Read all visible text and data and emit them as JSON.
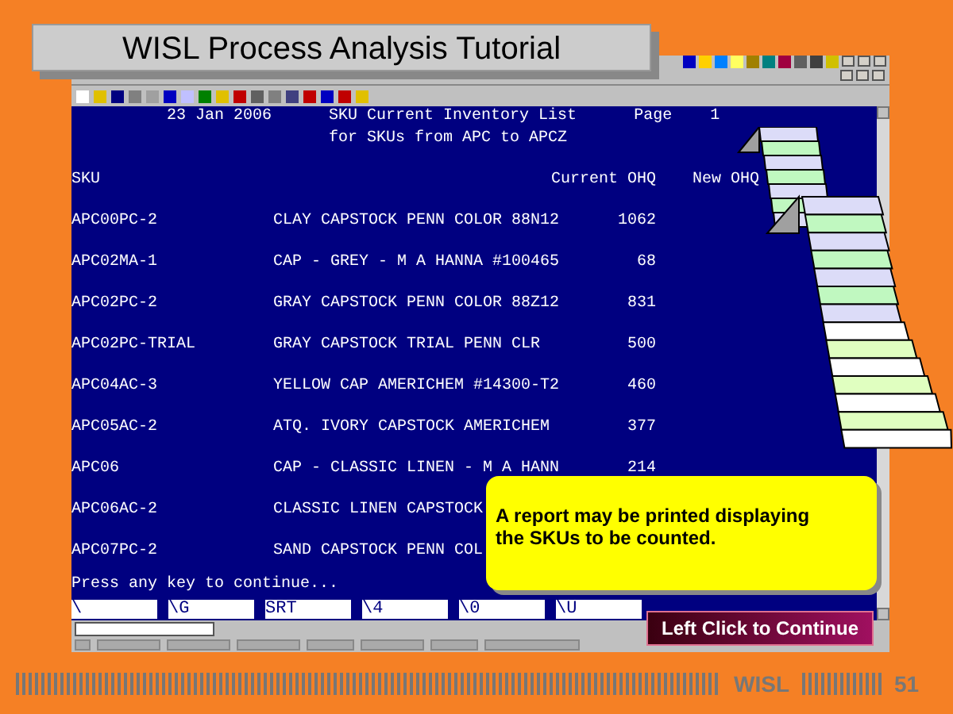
{
  "title": "WISL Process Analysis Tutorial",
  "report": {
    "date": "23 Jan 2006",
    "title": "SKU Current Inventory List",
    "page_label": "Page",
    "page": "1",
    "subtitle": "for SKUs from APC to APCZ",
    "columns": [
      "SKU",
      "Current OHQ",
      "New OHQ"
    ],
    "rows": [
      {
        "sku": "APC00PC-2",
        "description": "CLAY CAPSTOCK PENN COLOR 88N12",
        "current_ohq": "1062"
      },
      {
        "sku": "APC02MA-1",
        "description": "CAP - GREY - M A HANNA #100465",
        "current_ohq": "68"
      },
      {
        "sku": "APC02PC-2",
        "description": "GRAY CAPSTOCK PENN COLOR 88Z12",
        "current_ohq": "831"
      },
      {
        "sku": "APC02PC-TRIAL",
        "description": "GRAY CAPSTOCK TRIAL PENN CLR",
        "current_ohq": "500"
      },
      {
        "sku": "APC04AC-3",
        "description": "YELLOW CAP AMERICHEM #14300-T2",
        "current_ohq": "460"
      },
      {
        "sku": "APC05AC-2",
        "description": "ATQ. IVORY CAPSTOCK AMERICHEM",
        "current_ohq": "377"
      },
      {
        "sku": "APC06",
        "description": "CAP - CLASSIC LINEN - M A HANN",
        "current_ohq": "214"
      },
      {
        "sku": "APC06AC-2",
        "description": "CLASSIC LINEN CAPSTOCK"
      },
      {
        "sku": "APC07PC-2",
        "description": "SAND CAPSTOCK PENN COL"
      }
    ],
    "prompt": "Press any key to continue..."
  },
  "fields": [
    "\\",
    "\\G",
    "SRT",
    "\\4",
    "\\0",
    "\\U"
  ],
  "callout": "A report may be printed displaying the SKUs to be counted.",
  "continue_button": "Left Click to Continue",
  "footer": {
    "brand": "WISL",
    "page": "51"
  }
}
